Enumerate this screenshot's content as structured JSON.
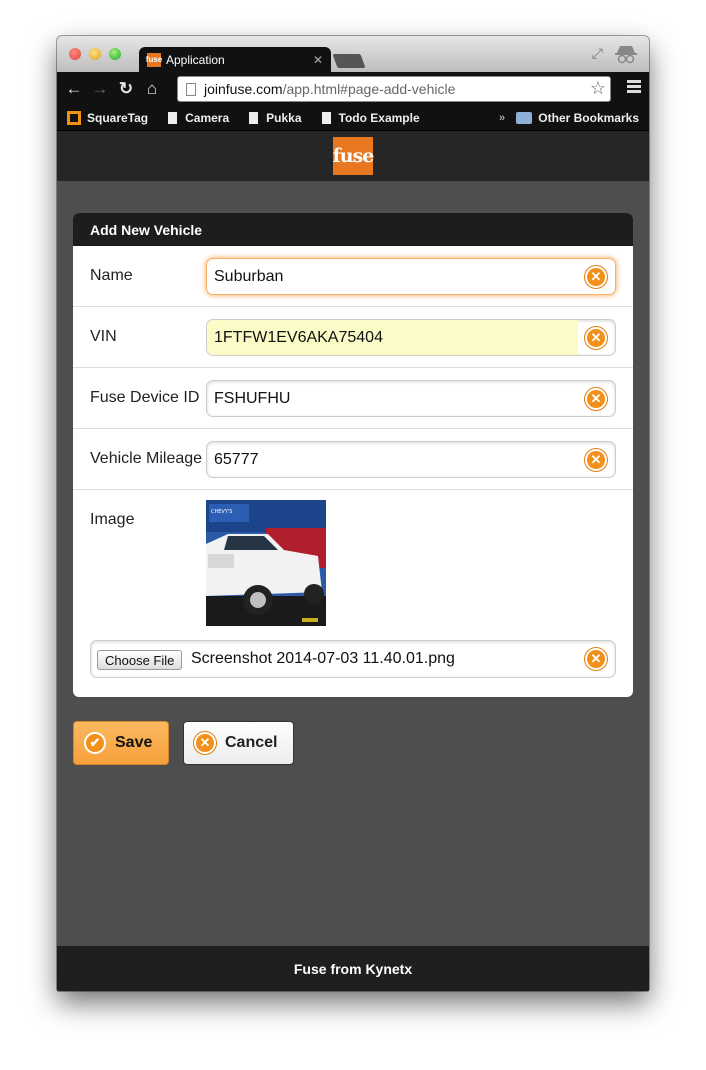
{
  "browser": {
    "tab_title": "Application",
    "tab_favicon": "fuse",
    "url_host": "joinfuse.com",
    "url_path": "/app.html#page-add-vehicle",
    "bookmarks": [
      "SquareTag",
      "Camera",
      "Pukka",
      "Todo Example"
    ],
    "other_bookmarks": "Other Bookmarks"
  },
  "app": {
    "logo_text": "fuse",
    "card_title": "Add New Vehicle",
    "fields": {
      "name": {
        "label": "Name",
        "value": "Suburban"
      },
      "vin": {
        "label": "VIN",
        "value": "1FTFW1EV6AKA75404"
      },
      "device": {
        "label": "Fuse Device ID",
        "value": "FSHUFHU"
      },
      "mileage": {
        "label": "Vehicle Mileage",
        "value": "65777"
      }
    },
    "image": {
      "label": "Image",
      "choose_file": "Choose File",
      "file_name": "Screenshot 2014-07-03 11.40.01.png",
      "sign_text": "CHEVY'S"
    },
    "buttons": {
      "save": "Save",
      "cancel": "Cancel"
    },
    "footer": "Fuse from Kynetx"
  },
  "colors": {
    "accent": "#f39019",
    "brand": "#e87722"
  }
}
